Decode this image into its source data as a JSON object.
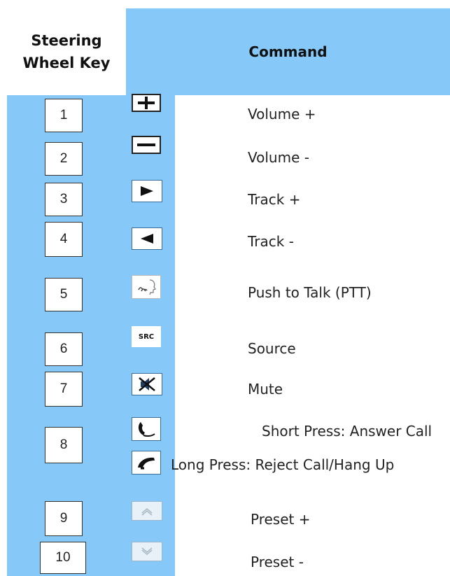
{
  "header": {
    "key_col_line1": "Steering",
    "key_col_line2": "Wheel Key",
    "command_col": "Command"
  },
  "colors": {
    "header_blue": "#86c8f7",
    "cell_blue": "#86c8f7",
    "text": "#222222"
  },
  "rows": [
    {
      "key": "1",
      "icon": "plus-icon",
      "command": "Volume +"
    },
    {
      "key": "2",
      "icon": "minus-icon",
      "command": "Volume -"
    },
    {
      "key": "3",
      "icon": "play-right-icon",
      "command": "Track +"
    },
    {
      "key": "4",
      "icon": "play-left-icon",
      "command": "Track -"
    },
    {
      "key": "5",
      "icon": "push-to-talk-icon",
      "command": "Push to Talk (PTT)"
    },
    {
      "key": "6",
      "icon": "src-icon",
      "icon_text": "SRC",
      "command": "Source"
    },
    {
      "key": "7",
      "icon": "mute-icon",
      "command": "Mute"
    },
    {
      "key": "8",
      "icon": "phone-answer-icon",
      "icon2": "phone-hangup-icon",
      "command": "Short Press:  Answer Call",
      "command2": "Long Press:  Reject Call/Hang Up"
    },
    {
      "key": "9",
      "icon": "chevron-up-icon",
      "command": "Preset +"
    },
    {
      "key": "10",
      "icon": "chevron-down-icon",
      "command": "Preset -"
    }
  ]
}
